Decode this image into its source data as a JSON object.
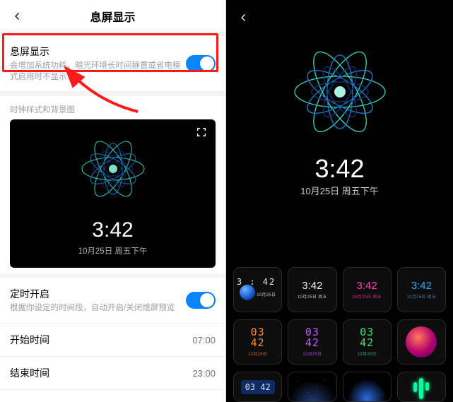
{
  "left": {
    "header_title": "息屏显示",
    "aod_toggle": {
      "title": "息屏显示",
      "subtitle": "会增加系统功耗，暗光环境长时间静置或省电模式启用时不显示"
    },
    "style_section_label": "时钟样式和背景图",
    "preview": {
      "time": "3:42",
      "date": "10月25日 周五下午"
    },
    "schedule": {
      "title": "定时开启",
      "subtitle": "根据你设定的时间段，自动开启/关闭熄屏预览"
    },
    "start": {
      "label": "开始时间",
      "value": "07:00"
    },
    "end": {
      "label": "结束时间",
      "value": "23:00"
    }
  },
  "right": {
    "time": "3:42",
    "date": "10月25日  周五下午",
    "tiles": {
      "r1": [
        {
          "time": "3 : 42",
          "date": "10月25日"
        },
        {
          "time": "3:42",
          "date": "10月25日 周五"
        },
        {
          "time": "3:42",
          "date": "10月25日 周五"
        },
        {
          "time": "3:42",
          "date": "10月25日 周五"
        }
      ],
      "r2": [
        {
          "time": "03\n42",
          "date": "10月25日"
        },
        {
          "time": "03\n42",
          "date": "10月25日"
        },
        {
          "time": "03\n42",
          "date": "10月25日"
        }
      ],
      "r3": [
        {
          "time": "03 42"
        }
      ]
    }
  }
}
